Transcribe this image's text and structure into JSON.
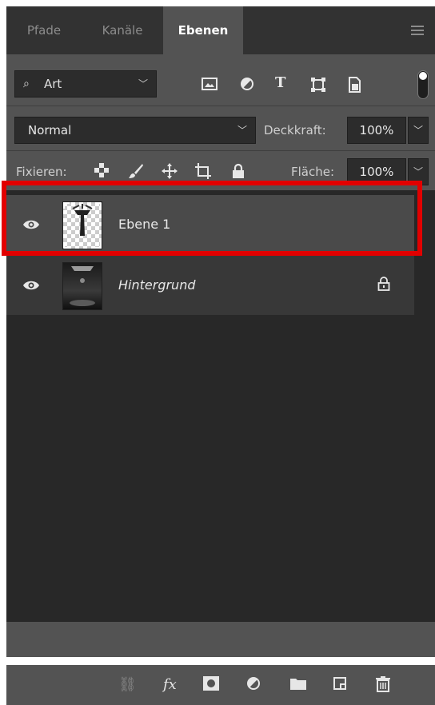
{
  "tabs": [
    {
      "label": "Pfade",
      "active": false
    },
    {
      "label": "Kanäle",
      "active": false
    },
    {
      "label": "Ebenen",
      "active": true
    }
  ],
  "filter": {
    "kind_label": "Art",
    "icons": [
      "image-filter-icon",
      "adjustment-filter-icon",
      "type-filter-icon",
      "shape-filter-icon",
      "smart-object-filter-icon"
    ]
  },
  "blend": {
    "mode": "Normal",
    "opacity_label": "Deckkraft:",
    "opacity_value": "100%"
  },
  "lock": {
    "label": "Fixieren:",
    "fill_label": "Fläche:",
    "fill_value": "100%",
    "icons": [
      "lock-transparent-icon",
      "lock-paint-icon",
      "lock-move-icon",
      "lock-artboard-icon",
      "lock-all-icon"
    ]
  },
  "layers": [
    {
      "name": "Ebene 1",
      "selected": true,
      "visible": true,
      "locked": false
    },
    {
      "name": "Hintergrund",
      "selected": false,
      "visible": true,
      "locked": true
    }
  ],
  "colors": {
    "highlight": "#e20000",
    "panel_bg": "#535353",
    "list_bg": "#282828"
  }
}
